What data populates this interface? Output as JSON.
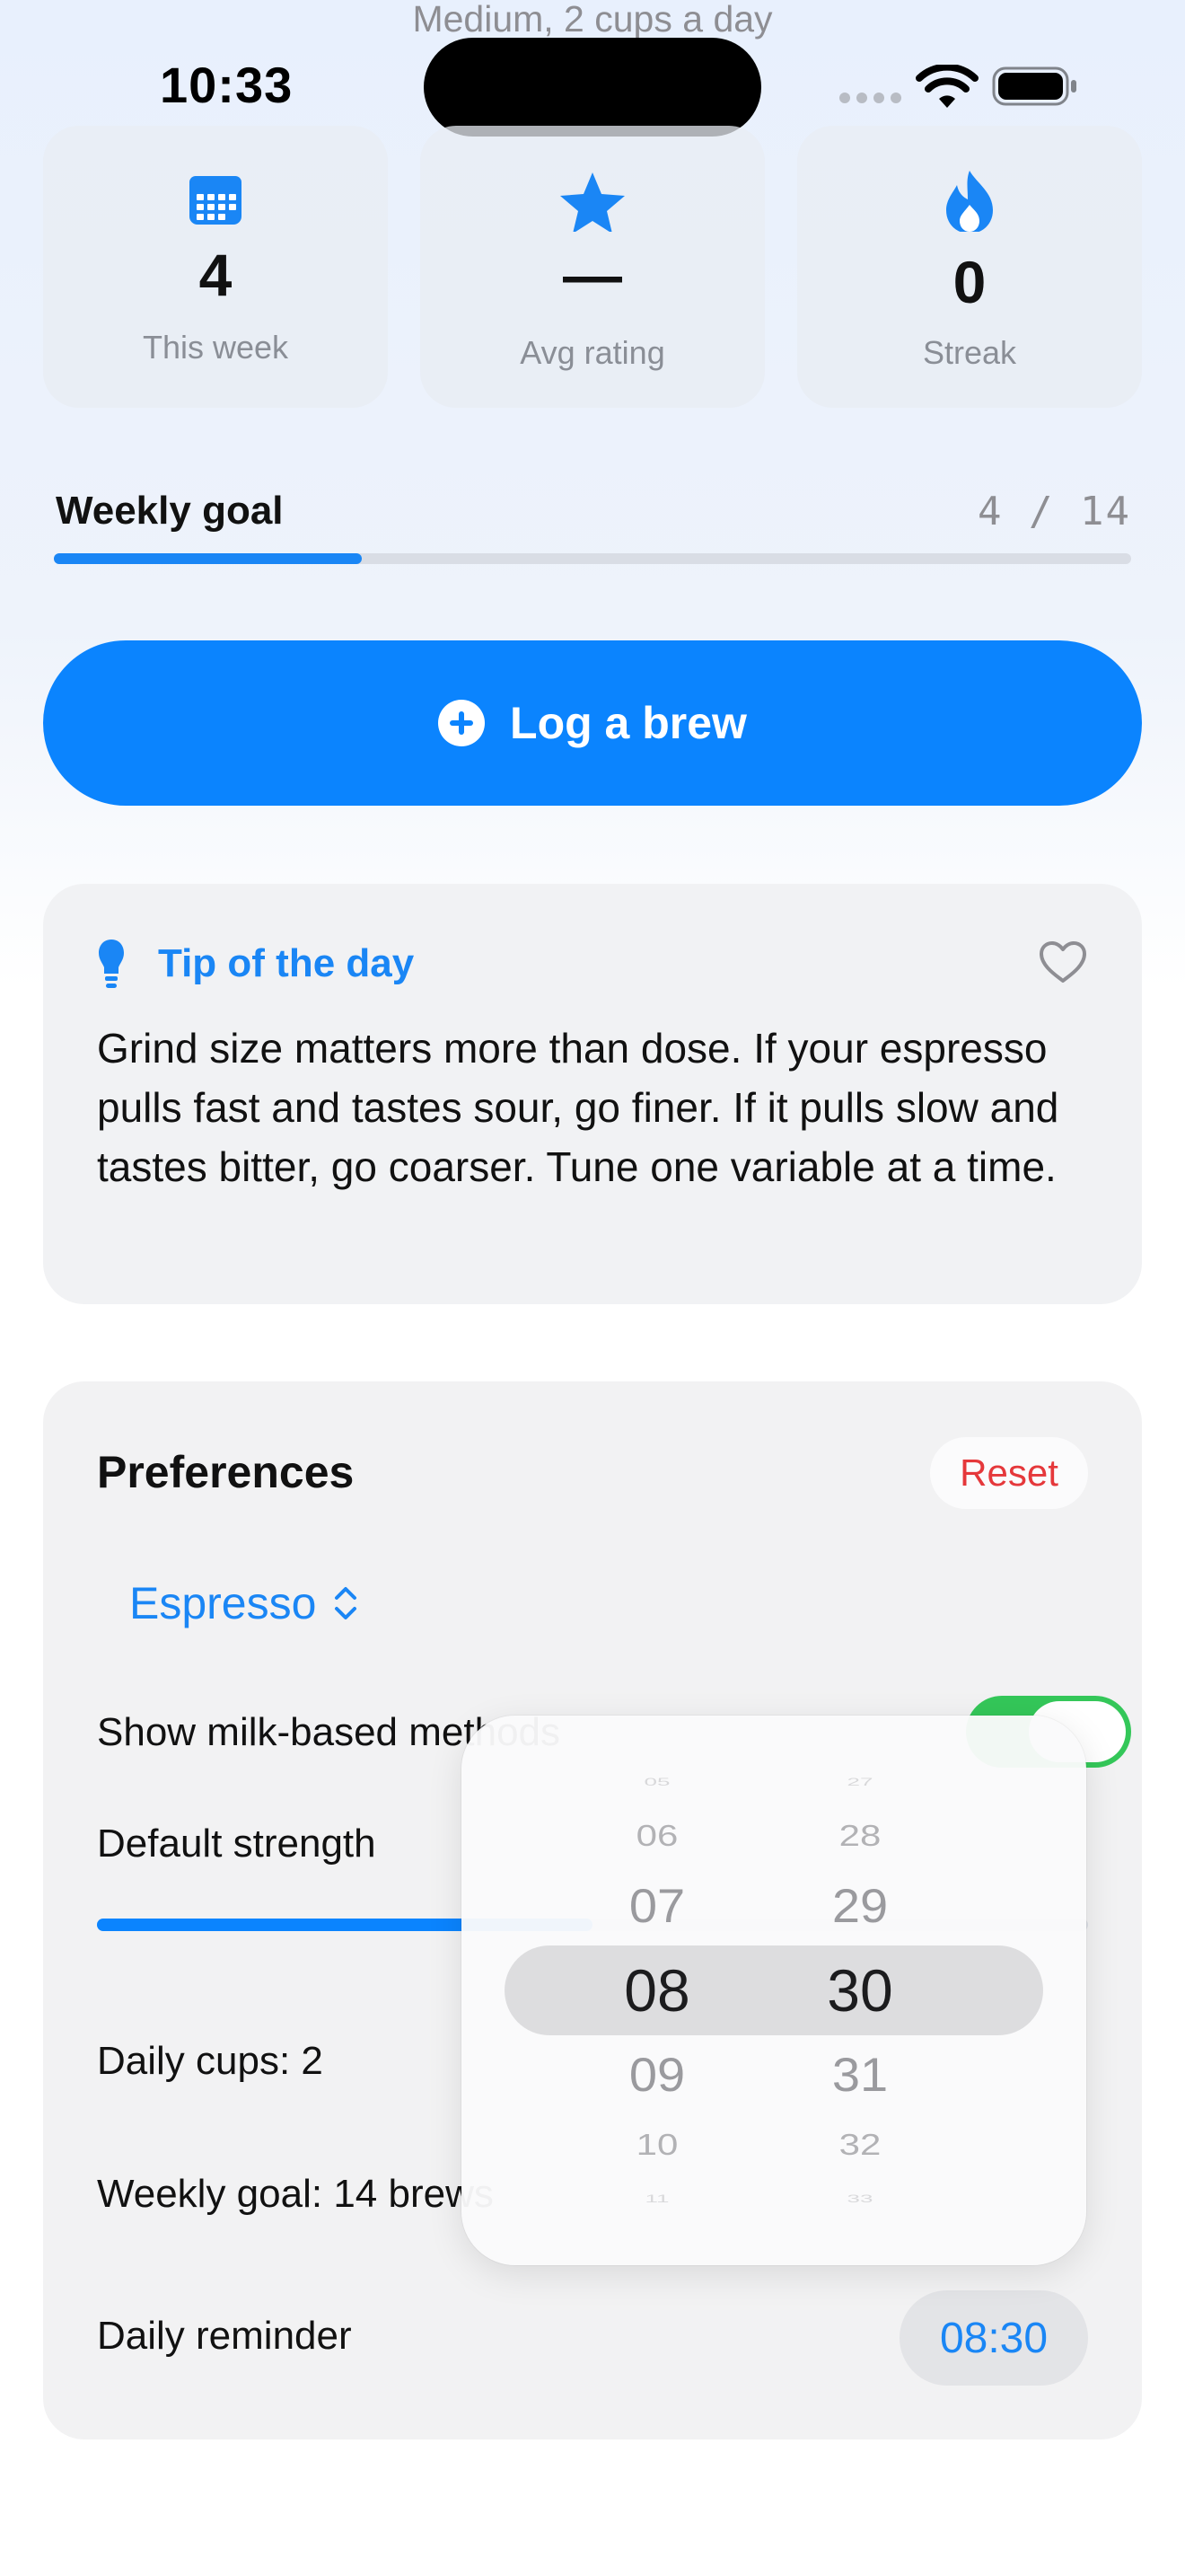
{
  "status_bar": {
    "peek_subtitle": "Medium, 2 cups a day",
    "time": "10:33"
  },
  "stats": [
    {
      "icon": "calendar-icon",
      "value": "4",
      "label": "This week"
    },
    {
      "icon": "star-icon",
      "value": "—",
      "label": "Avg rating"
    },
    {
      "icon": "flame-icon",
      "value": "0",
      "label": "Streak"
    }
  ],
  "weekly_goal": {
    "label": "Weekly goal",
    "current": "4",
    "separator": "/",
    "target": "14",
    "progress_fraction": 0.2857
  },
  "log_button": {
    "icon": "plus-circle-icon",
    "label": "Log a brew"
  },
  "tip": {
    "icon": "lightbulb-icon",
    "title": "Tip of the day",
    "favorite_icon": "heart-icon",
    "body": "Grind size matters more than dose. If your espresso pulls fast and tastes sour, go finer. If it pulls slow and tastes bitter, go coarser. Tune one variable at a time."
  },
  "preferences": {
    "title": "Preferences",
    "reset_label": "Reset",
    "method": "Espresso",
    "show_milk_label": "Show milk-based methods",
    "show_milk_on": true,
    "default_strength_label": "Default strength",
    "strength_fraction": 0.5,
    "daily_cups_label": "Daily cups: 2",
    "weekly_goal_label": "Weekly goal: 14 brews",
    "daily_reminder_label": "Daily reminder",
    "reminder_time": "08:30"
  },
  "time_picker": {
    "hours": [
      "05",
      "06",
      "07",
      "08",
      "09",
      "10",
      "11"
    ],
    "minutes": [
      "27",
      "28",
      "29",
      "30",
      "31",
      "32",
      "33"
    ],
    "selected_hour": "08",
    "selected_minute": "30"
  },
  "colors": {
    "accent": "#0b84fe",
    "destructive": "#e5383b",
    "toggle_on": "#34c759"
  }
}
